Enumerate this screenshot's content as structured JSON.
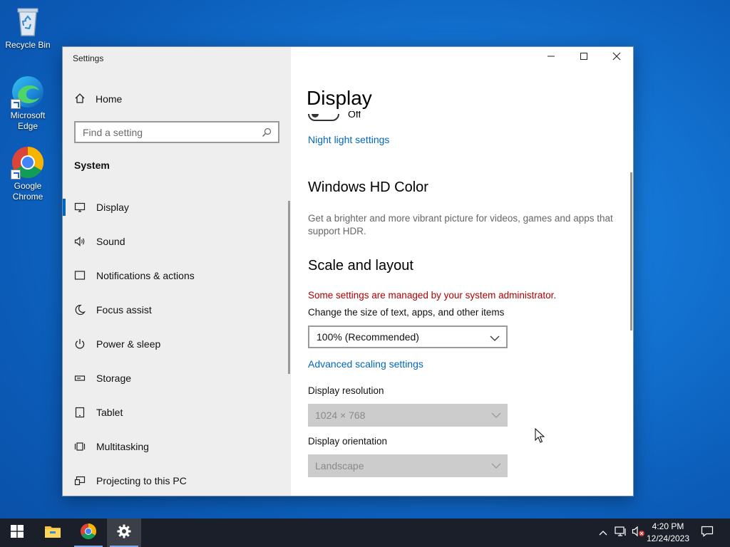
{
  "desktop": {
    "icons": [
      {
        "label": "Recycle Bin"
      },
      {
        "label": "Microsoft Edge"
      },
      {
        "label": "Google Chrome"
      }
    ]
  },
  "window": {
    "title": "Settings",
    "controls": {
      "minimize": "minimize-icon",
      "maximize": "maximize-icon",
      "close": "close-icon"
    }
  },
  "sidebar": {
    "home_label": "Home",
    "search_placeholder": "Find a setting",
    "section_title": "System",
    "items": [
      {
        "label": "Display",
        "icon": "monitor-icon",
        "active": true
      },
      {
        "label": "Sound",
        "icon": "speaker-icon",
        "active": false
      },
      {
        "label": "Notifications & actions",
        "icon": "notification-icon",
        "active": false
      },
      {
        "label": "Focus assist",
        "icon": "moon-icon",
        "active": false
      },
      {
        "label": "Power & sleep",
        "icon": "power-icon",
        "active": false
      },
      {
        "label": "Storage",
        "icon": "storage-icon",
        "active": false
      },
      {
        "label": "Tablet",
        "icon": "tablet-icon",
        "active": false
      },
      {
        "label": "Multitasking",
        "icon": "multitasking-icon",
        "active": false
      },
      {
        "label": "Projecting to this PC",
        "icon": "projecting-icon",
        "active": false
      }
    ]
  },
  "content": {
    "page_title": "Display",
    "night_light_state": "Off",
    "night_light_link": "Night light settings",
    "hd_color": {
      "heading": "Windows HD Color",
      "description": "Get a brighter and more vibrant picture for videos, games and apps that support HDR."
    },
    "scale_layout": {
      "heading": "Scale and layout",
      "admin_warning": "Some settings are managed by your system administrator.",
      "scale_label": "Change the size of text, apps, and other items",
      "scale_value": "100% (Recommended)",
      "advanced_link": "Advanced scaling settings",
      "resolution_label": "Display resolution",
      "resolution_value": "1024 × 768",
      "orientation_label": "Display orientation",
      "orientation_value": "Landscape"
    }
  },
  "taskbar": {
    "apps": [
      "start-icon",
      "file-explorer-icon",
      "chrome-icon",
      "settings-icon"
    ],
    "clock": {
      "time": "4:20 PM",
      "date": "12/24/2023"
    }
  },
  "colors": {
    "accent": "#0067c0",
    "warning": "#b00000",
    "sidebar_bg": "#eeeeee",
    "taskbar_bg": "#1b1f29"
  }
}
